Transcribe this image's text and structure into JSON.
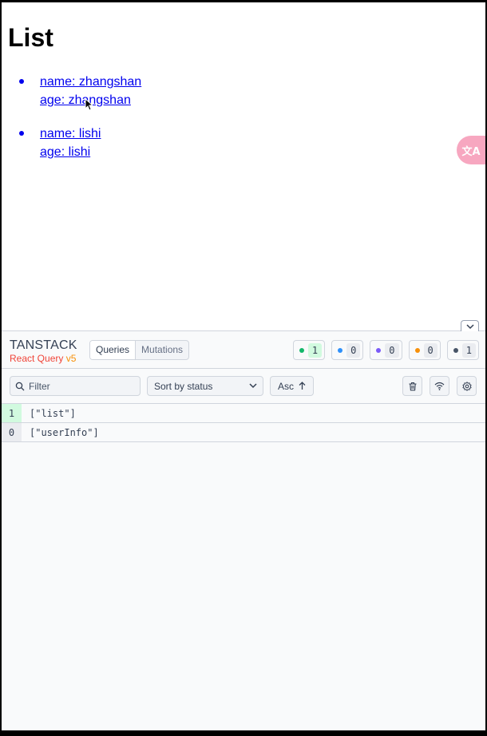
{
  "page": {
    "title": "List",
    "items": [
      {
        "name": "name: zhangshan",
        "age": "age: zhangshan"
      },
      {
        "name": "name: lishi",
        "age": "age: lishi"
      }
    ]
  },
  "translate_button": {
    "label": "文A"
  },
  "devtools": {
    "logo": {
      "title": "TANSTACK",
      "subtitle": "React Query",
      "version": "v5"
    },
    "tabs": [
      {
        "label": "Queries",
        "active": true
      },
      {
        "label": "Mutations",
        "active": false
      }
    ],
    "status_counts": [
      {
        "status": "fresh",
        "color": "#12b76a",
        "count": "1"
      },
      {
        "status": "fetching",
        "color": "#2e90fa",
        "count": "0"
      },
      {
        "status": "paused",
        "color": "#7a5af8",
        "count": "0"
      },
      {
        "status": "stale",
        "color": "#f79009",
        "count": "0"
      },
      {
        "status": "inactive",
        "color": "#475467",
        "count": "1"
      }
    ],
    "filter": {
      "placeholder": "Filter",
      "value": ""
    },
    "sort": {
      "selected": "Sort by status"
    },
    "order": {
      "label": "Asc"
    },
    "queries": [
      {
        "observers": "1",
        "key": "[\"list\"]",
        "status": "fresh"
      },
      {
        "observers": "0",
        "key": "[\"userInfo\"]",
        "status": "inactive"
      }
    ],
    "icons": [
      "trash-icon",
      "wifi-icon",
      "settings-icon",
      "chevron-down-icon",
      "search-icon",
      "arrow-up-icon"
    ]
  }
}
